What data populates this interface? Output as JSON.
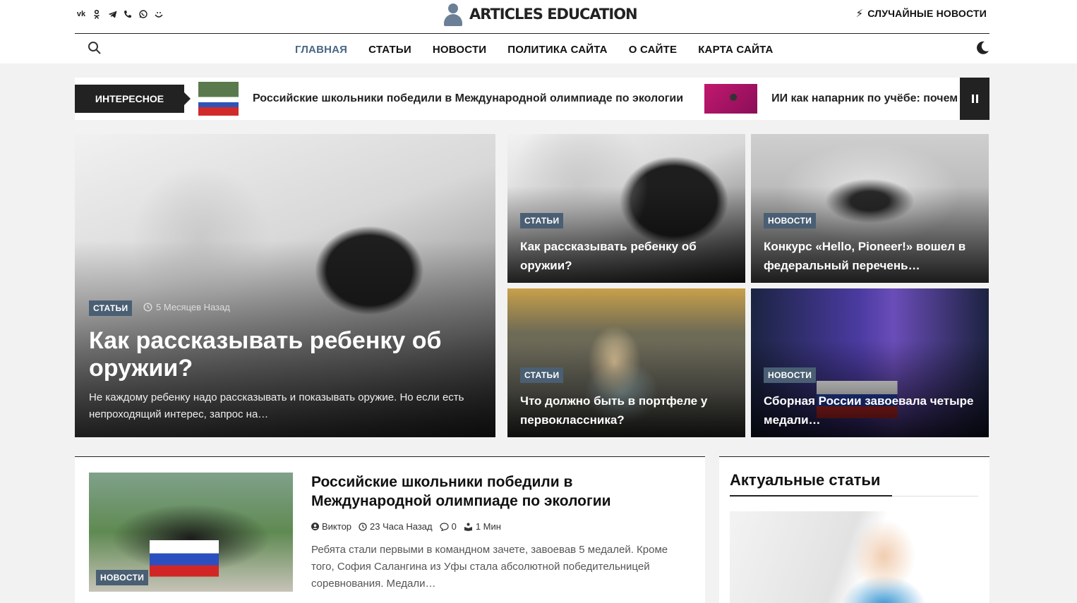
{
  "header": {
    "logo_text": "ARTICLES EDUCATION",
    "random_news": "СЛУЧАЙНЫЕ НОВОСТИ",
    "social": [
      "vk-icon",
      "ok-icon",
      "telegram-icon",
      "viber-icon",
      "whatsapp-icon",
      "max-icon"
    ]
  },
  "nav": [
    {
      "label": "ГЛАВНАЯ",
      "active": true
    },
    {
      "label": "СТАТЬИ",
      "active": false
    },
    {
      "label": "НОВОСТИ",
      "active": false
    },
    {
      "label": "ПОЛИТИКА САЙТА",
      "active": false
    },
    {
      "label": "О САЙТЕ",
      "active": false
    },
    {
      "label": "КАРТА САЙТА",
      "active": false
    }
  ],
  "ticker": {
    "label": "ИНТЕРЕСНОЕ",
    "items": [
      "Российские школьники победили в Международной олимпиаде по экологии",
      "ИИ как напарник по учёбе: почем"
    ]
  },
  "hero": {
    "main": {
      "category": "СТАТЬИ",
      "time": "5 Месяцев Назад",
      "title": "Как рассказывать ребенку об оружии?",
      "excerpt": "Не каждому ребенку надо рассказывать и показывать оружие. Но если есть непроходящий интерес, запрос на…"
    },
    "small": [
      {
        "category": "СТАТЬИ",
        "title": "Как рассказывать ребенку об оружии?"
      },
      {
        "category": "НОВОСТИ",
        "title": "Конкурс «Hello, Pioneer!» вошел в федеральный перечень…"
      },
      {
        "category": "СТАТЬИ",
        "title": "Что должно быть в портфеле у первоклассника?"
      },
      {
        "category": "НОВОСТИ",
        "title": "Сборная России завоевала четыре медали…"
      }
    ]
  },
  "post": {
    "category": "НОВОСТИ",
    "title": "Российские школьники победили в Международной олимпиаде по экологии",
    "author": "Виктор",
    "time": "23 Часа Назад",
    "comments": "0",
    "read_time": "1 Мин",
    "excerpt": "Ребята стали первыми в командном зачете, завоевав 5 медалей. Кроме того, София Салангина из Уфы стала абсолютной победительницей соревнования. Медали…"
  },
  "sidebar": {
    "title": "Актуальные статьи"
  },
  "colors": {
    "accent": "#4a6785",
    "badge": "#4a5f73",
    "dark": "#222222"
  }
}
